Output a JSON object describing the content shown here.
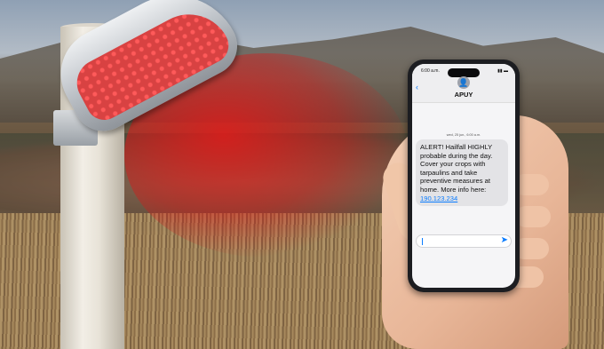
{
  "phone": {
    "status_time": "6:00 a.m.",
    "contact_name": "APUY",
    "back_glyph": "‹",
    "avatar_glyph": "👤",
    "timestamp": "wed, 25 jun., 6:00 a.m.",
    "message_text": "ALERT! Hailfall HIGHLY probable during the day. Cover your crops with tarpaulins and take preventive measures at home. More info here: ",
    "message_link": "190.123.234",
    "input_value": "",
    "send_glyph": "➤",
    "accent": "#0a7cff"
  },
  "scene": {
    "lamp_light_color": "#e61919"
  }
}
